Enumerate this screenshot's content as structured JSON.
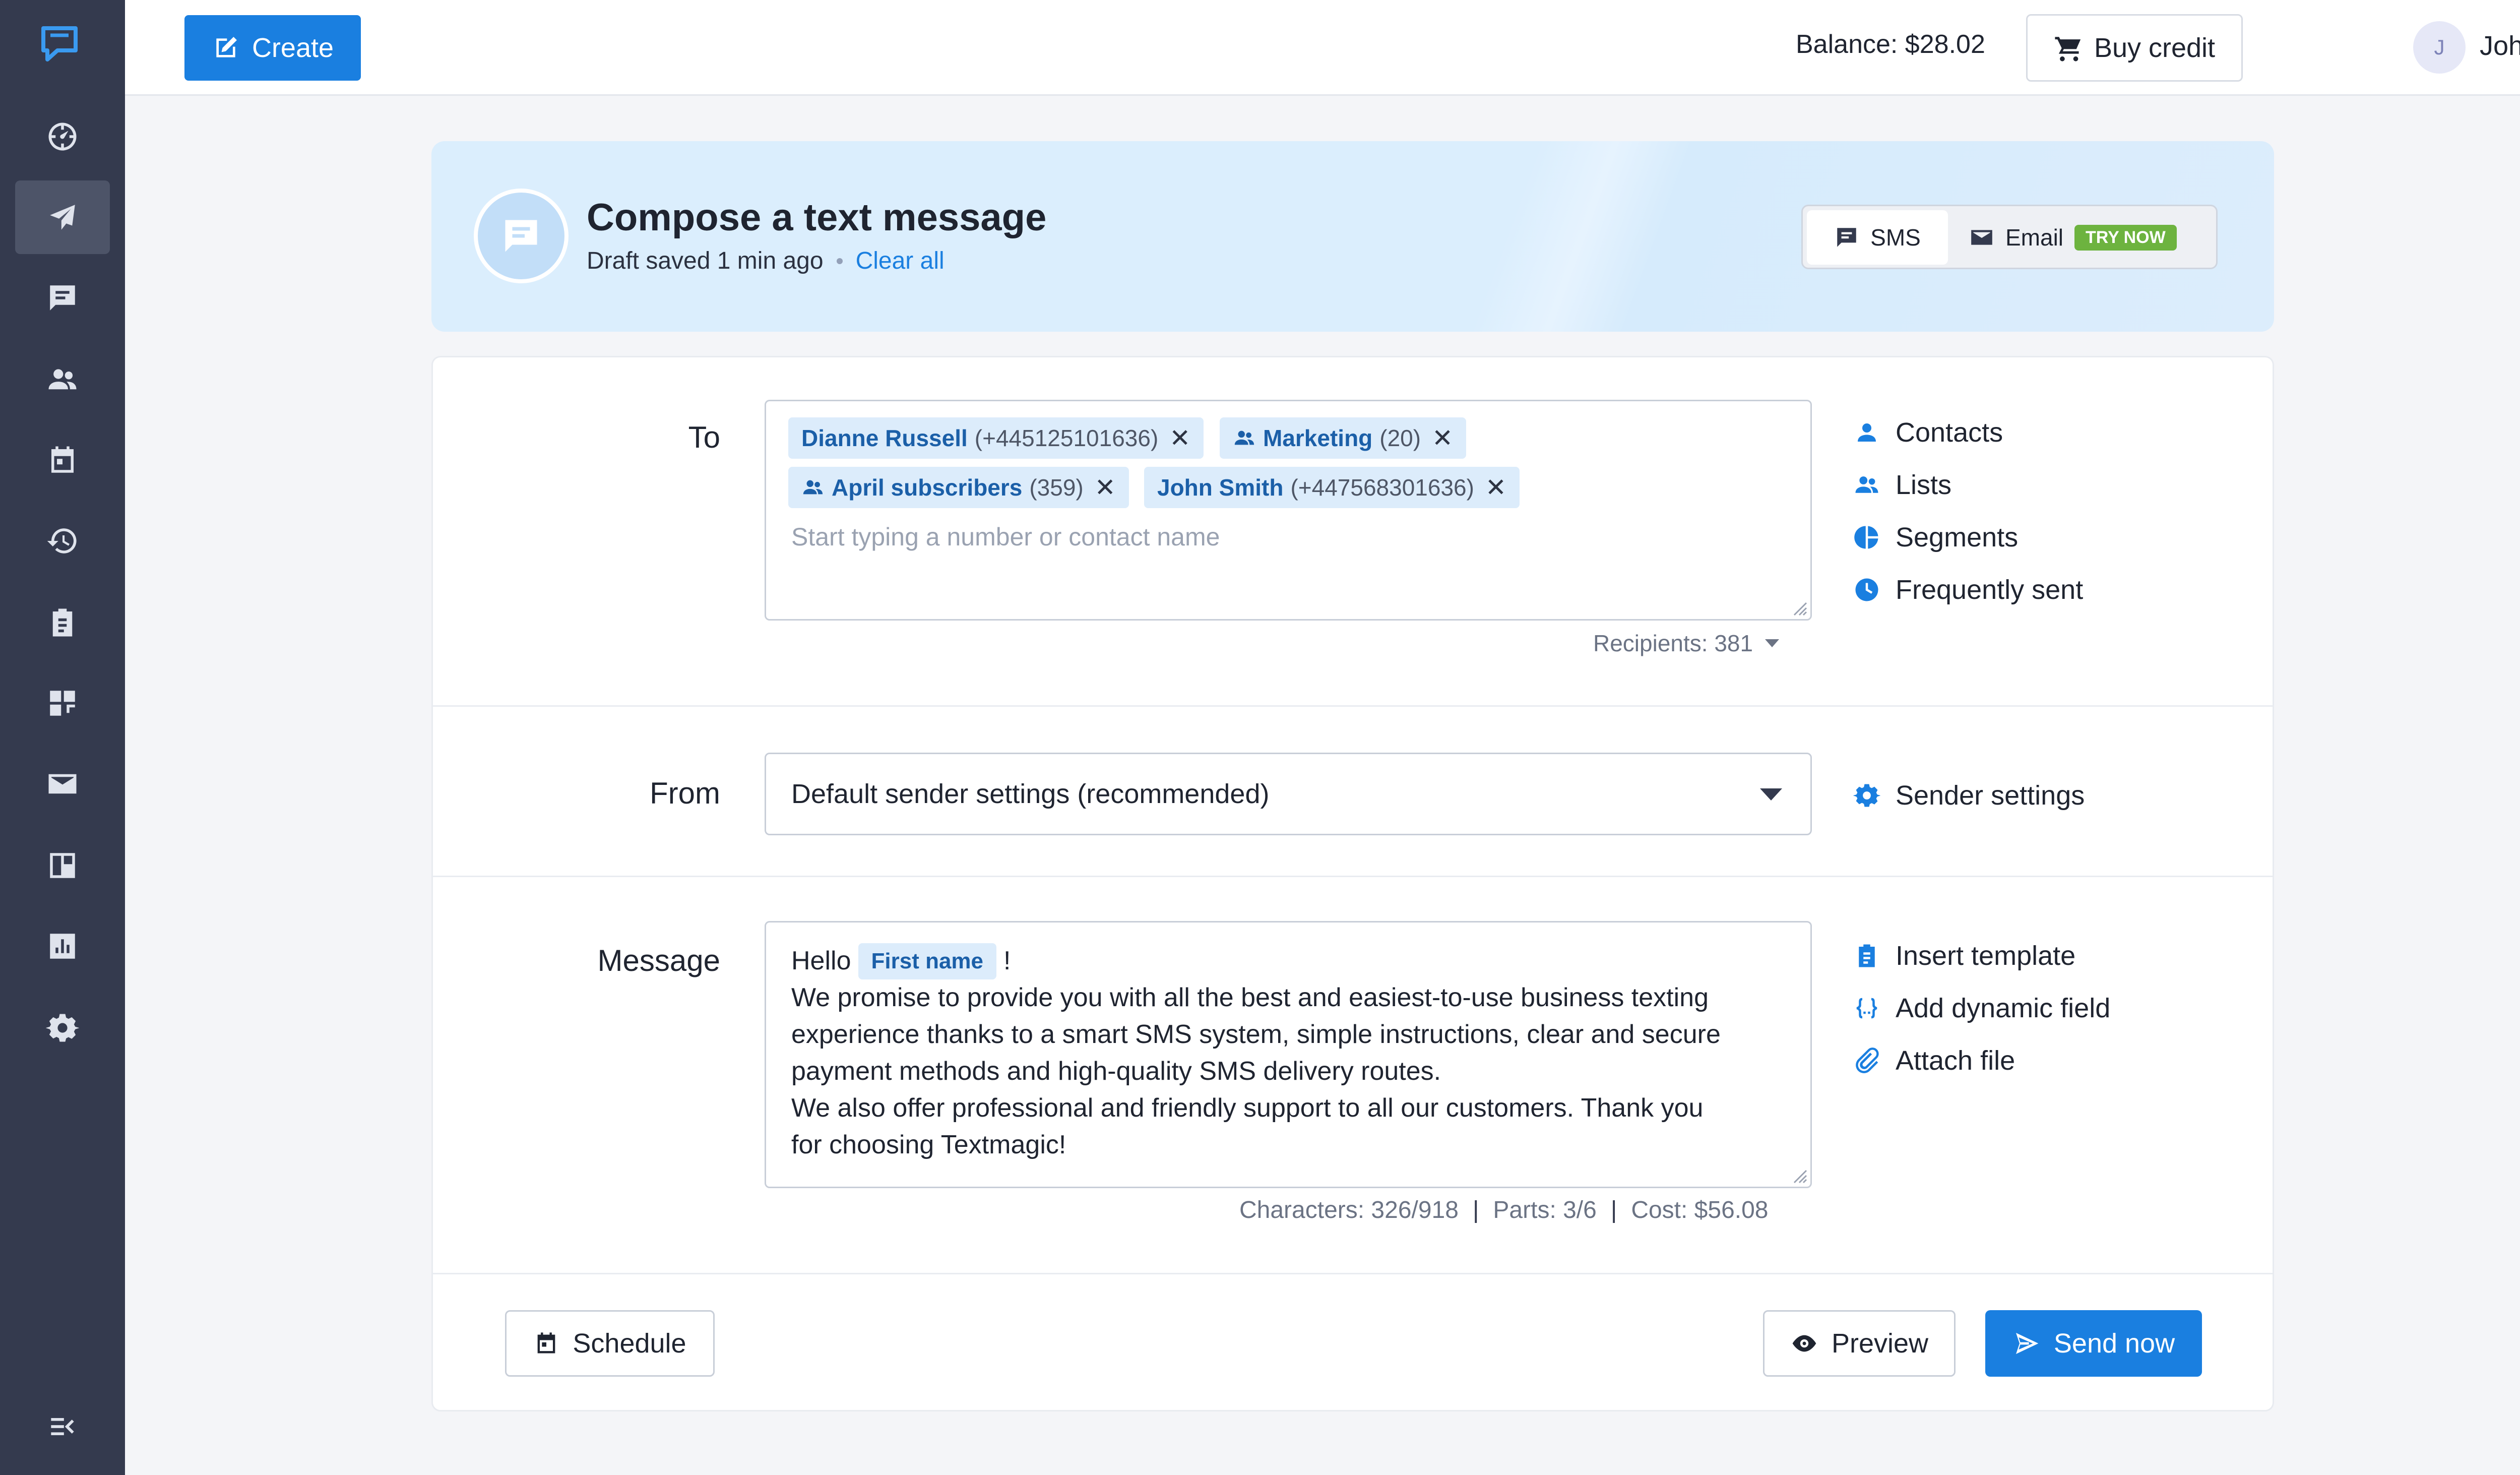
{
  "sidebar": {
    "items": [
      {
        "icon": "dashboard-icon",
        "active": false
      },
      {
        "icon": "send-icon",
        "active": true
      },
      {
        "icon": "chat-icon",
        "active": false
      },
      {
        "icon": "contacts-icon",
        "active": false
      },
      {
        "icon": "calendar-icon",
        "active": false
      },
      {
        "icon": "history-icon",
        "active": false
      },
      {
        "icon": "templates-icon",
        "active": false
      },
      {
        "icon": "apps-icon",
        "active": false
      },
      {
        "icon": "email-icon",
        "active": false
      },
      {
        "icon": "forms-icon",
        "active": false
      },
      {
        "icon": "reports-icon",
        "active": false
      },
      {
        "icon": "settings-icon",
        "active": false
      }
    ]
  },
  "topbar": {
    "create_label": "Create",
    "balance": "Balance: $28.02",
    "buy_credit_label": "Buy credit",
    "avatar_initial": "J",
    "user_name": "John Doe"
  },
  "compose": {
    "title": "Compose a text message",
    "draft_status": "Draft saved 1 min ago",
    "clear_all": "Clear all",
    "channels": {
      "sms_label": "SMS",
      "email_label": "Email",
      "email_badge": "TRY NOW"
    }
  },
  "form": {
    "to_label": "To",
    "recipients_chips": [
      {
        "name": "Dianne Russell",
        "detail": "(+445125101636)",
        "group": false
      },
      {
        "name": "Marketing",
        "detail": "(20)",
        "group": true
      },
      {
        "name": "April subscribers",
        "detail": "(359)",
        "group": true
      },
      {
        "name": "John Smith",
        "detail": "(+447568301636)",
        "group": false
      }
    ],
    "to_placeholder": "Start typing a number or contact name",
    "recipients_count": "Recipients: 381",
    "to_links": {
      "contacts": "Contacts",
      "lists": "Lists",
      "segments": "Segments",
      "frequently_sent": "Frequently sent"
    },
    "from_label": "From",
    "from_value": "Default sender settings (recommended)",
    "sender_settings": "Sender settings",
    "message_label": "Message",
    "message_greeting": "Hello",
    "message_field": "First name",
    "message_after_field": "!",
    "message_body": "We promise to provide you with all the best and easiest-to-use business texting\nexperience thanks to a smart SMS system, simple instructions, clear and secure\npayment methods and high-quality SMS delivery routes.\nWe also offer professional and friendly support to all our customers. Thank you\nfor choosing Textmagic!",
    "message_links": {
      "insert_template": "Insert template",
      "add_dynamic_field": "Add dynamic field",
      "attach_file": "Attach file"
    },
    "stats": {
      "characters": "Characters: 326/918",
      "parts": "Parts: 3/6",
      "cost": "Cost: $56.08",
      "separator": "|"
    }
  },
  "actions": {
    "schedule": "Schedule",
    "preview": "Preview",
    "send_now": "Send now"
  },
  "colors": {
    "accent": "#1a7fe0",
    "sidebar_bg": "#343a4e",
    "chip_bg": "#dcecfb",
    "badge_green": "#6db33f"
  }
}
